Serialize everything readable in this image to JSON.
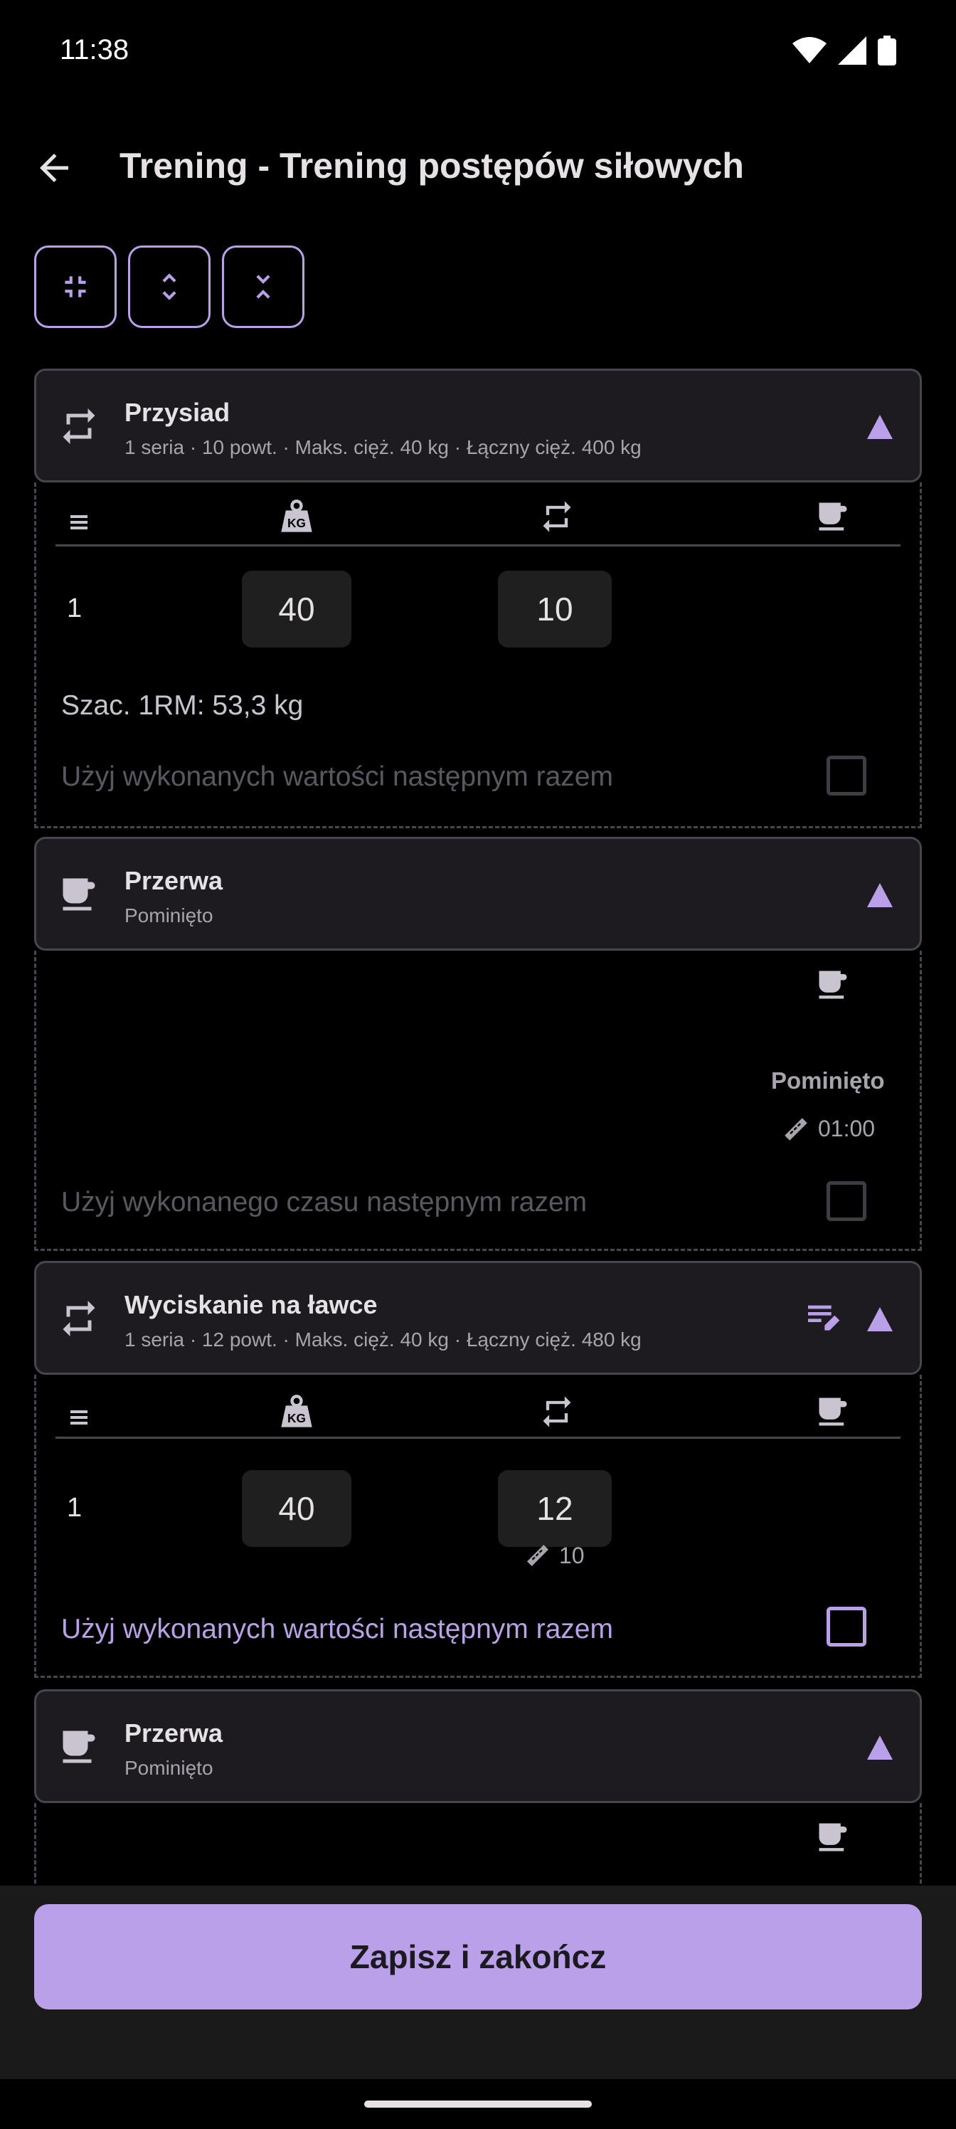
{
  "status_bar": {
    "time": "11:38"
  },
  "header": {
    "title": "Trening - Trening postępów siłowych"
  },
  "exercise1": {
    "name": "Przysiad",
    "summary": "1 seria · 10 powt. · Maks. cięż. 40 kg · Łączny cięż. 400 kg",
    "set_number": "1",
    "weight": "40",
    "reps": "10",
    "estimated_1rm": "Szac. 1RM: 53,3 kg",
    "use_values_label": "Użyj wykonanych wartości następnym razem"
  },
  "rest1": {
    "name": "Przerwa",
    "status": "Pominięto",
    "status_detail": "Pominięto",
    "target_time": "01:00",
    "use_time_label": "Użyj wykonanego czasu następnym razem"
  },
  "exercise2": {
    "name": "Wyciskanie na ławce",
    "summary": "1 seria · 12 powt. · Maks. cięż. 40 kg · Łączny cięż. 480 kg",
    "set_number": "1",
    "weight": "40",
    "reps": "12",
    "target_reps": "10",
    "use_values_label": "Użyj wykonanych wartości następnym razem"
  },
  "rest2": {
    "name": "Przerwa",
    "status": "Pominięto"
  },
  "footer": {
    "save_label": "Zapisz i zakończ"
  },
  "colors": {
    "accent": "#b9a0e8",
    "card_bg": "#1d1b20",
    "outline": "#49454f"
  }
}
